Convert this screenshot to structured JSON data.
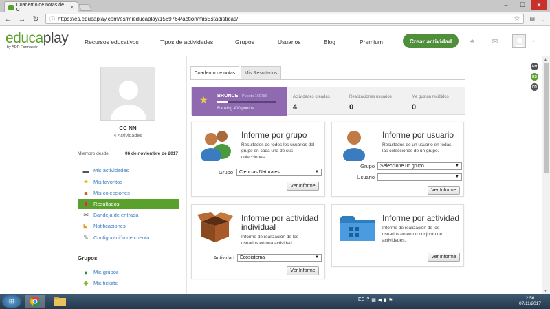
{
  "browser": {
    "tab_title": "Cuaderno de notas de C",
    "url": "https://es.educaplay.com/es/mieducaplay/1569764/action/misEstadisticas/"
  },
  "header": {
    "logo_main": "educa",
    "logo_accent": "play",
    "logo_sub": "by ADR Formación",
    "nav": [
      "Recursos educativos",
      "Tipos de actividades",
      "Grupos",
      "Usuarios",
      "Blog",
      "Premium"
    ],
    "cta": "Crear actividad"
  },
  "languages": [
    "EN",
    "ES",
    "FR"
  ],
  "profile": {
    "name": "CC NN",
    "activities": "4 Actividades",
    "member_since_label": "Miembro desde:",
    "member_since_value": "06 de noviembre de 2017"
  },
  "sidebar": {
    "items": [
      {
        "label": "Mis actividades",
        "icon": "activities-icon"
      },
      {
        "label": "Mis favoritos",
        "icon": "star-icon"
      },
      {
        "label": "Mis colecciones",
        "icon": "box-icon"
      },
      {
        "label": "Resultados",
        "icon": "bar-chart-icon"
      },
      {
        "label": "Bandeja de entrada",
        "icon": "envelope-icon"
      },
      {
        "label": "Notificaciones",
        "icon": "megaphone-icon"
      },
      {
        "label": "Configuración de cuenta",
        "icon": "wrench-icon"
      }
    ],
    "groups_title": "Grupos",
    "group_items": [
      {
        "label": "Mis grupos",
        "icon": "people-icon"
      },
      {
        "label": "Mis tickets",
        "icon": "ticket-icon"
      }
    ]
  },
  "tabs": [
    "Cuaderno de notas",
    "Mis Resultados"
  ],
  "stats": {
    "level": "BRONCE",
    "puesto": "Puesto 169788",
    "ranking": "Ranking 400 puntos",
    "progress": 0.17,
    "items": [
      {
        "label": "Actividades creadas",
        "value": "4"
      },
      {
        "label": "Realizaciones usuarios",
        "value": "0"
      },
      {
        "label": "Me gustan recibidos",
        "value": "0"
      }
    ]
  },
  "cards": {
    "group": {
      "title": "Informe por grupo",
      "desc": [
        "Resultados de todos los usuarios del",
        "grupo en cada una de sus",
        "colecciones."
      ],
      "field_label": "Grupo",
      "field_value": "Ciencias Naturales",
      "button": "Ver Informe"
    },
    "user": {
      "title": "Informe por usuario",
      "desc": [
        "Resultados de un usuario en todas",
        "las colecciones de un grupo."
      ],
      "group_label": "Grupo",
      "group_value": "Seleccione un grupo",
      "user_label": "Usuario",
      "user_value": "",
      "button": "Ver Informe"
    },
    "activity_individual": {
      "title_1": "Informe por actividad",
      "title_2": "individual",
      "desc": [
        "Informe de realización de los",
        "usuarios en una actividad."
      ],
      "field_label": "Actividad",
      "field_value": "Ecosistema",
      "button": "Ver Informe"
    },
    "activity_set": {
      "title": "Informe por actividad",
      "desc": [
        "Informe de realización de los",
        "usuarios en en un conjunto de",
        "actividades."
      ],
      "button": "Ver Informe"
    }
  },
  "taskbar": {
    "lang": "ES",
    "time": "2:56",
    "date": "07/11/2017"
  }
}
